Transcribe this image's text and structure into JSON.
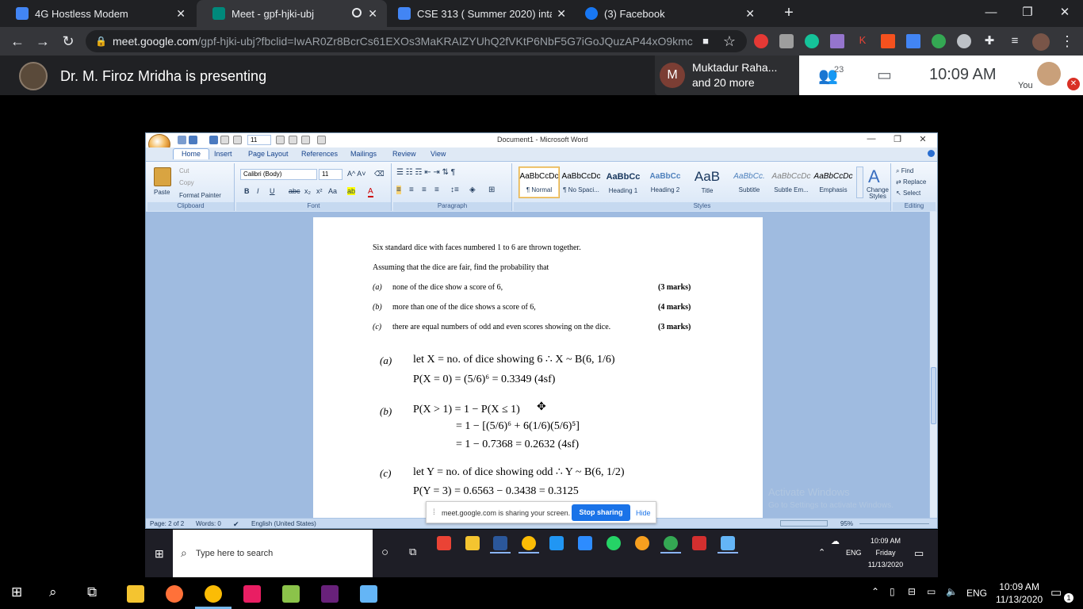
{
  "tabs": [
    {
      "label": "4G Hostless Modem",
      "color": "#4285f4"
    },
    {
      "label": "Meet - gpf-hjki-ubj",
      "color": "#00897b"
    },
    {
      "label": "CSE 313 ( Summer 2020) intake 3",
      "color": "#4285f4"
    },
    {
      "label": "(3) Facebook",
      "color": "#1877f2"
    }
  ],
  "window_controls": {
    "minimize": "—",
    "maximize": "❐",
    "close": "✕"
  },
  "new_tab": "+",
  "address": {
    "host": "meet.google.com",
    "path": "/gpf-hjki-ubj?fbclid=IwAR0Zr8BcrCs61EXOs3MaKRAIZYUhQ2fVKtP6NbF5G7iGoJQuzAP44xO9kmc"
  },
  "meet": {
    "presenting": "Dr. M. Firoz Mridha is presenting",
    "chip_initial": "M",
    "chip_line1": "Muktadur Raha...",
    "chip_line2": "and 20 more",
    "people_count": "23",
    "time": "10:09  AM",
    "you": "You"
  },
  "word": {
    "title": "Document1 - Microsoft Word",
    "qat_font_size": "11",
    "tabs": [
      "Home",
      "Insert",
      "Page Layout",
      "References",
      "Mailings",
      "Review",
      "View"
    ],
    "clipboard": {
      "paste": "Paste",
      "cut": "Cut",
      "copy": "Copy",
      "format_painter": "Format Painter",
      "label": "Clipboard"
    },
    "font": {
      "name": "Calibri (Body)",
      "size": "11",
      "label": "Font"
    },
    "paragraph_label": "Paragraph",
    "styles": [
      {
        "preview": "AaBbCcDc",
        "name": "¶ Normal"
      },
      {
        "preview": "AaBbCcDc",
        "name": "¶ No Spaci..."
      },
      {
        "preview": "AaBbCc",
        "name": "Heading 1"
      },
      {
        "preview": "AaBbCc",
        "name": "Heading 2"
      },
      {
        "preview": "AaB",
        "name": "Title"
      },
      {
        "preview": "AaBbCc.",
        "name": "Subtitle"
      },
      {
        "preview": "AaBbCcDc",
        "name": "Subtle Em..."
      },
      {
        "preview": "AaBbCcDc",
        "name": "Emphasis"
      }
    ],
    "styles_label": "Styles",
    "change_styles": "Change Styles",
    "editing": {
      "find": "Find",
      "replace": "Replace",
      "select": "Select",
      "label": "Editing"
    },
    "status": {
      "page": "Page: 2 of 2",
      "words": "Words: 0",
      "language": "English (United States)",
      "zoom": "95%"
    }
  },
  "document": {
    "intro1": "Six standard dice with faces numbered 1 to 6 are thrown together.",
    "intro2": "Assuming that the dice are fair, find the probability that",
    "questions": [
      {
        "label": "(a)",
        "text": "none of the dice show a score of 6,",
        "marks": "(3 marks)"
      },
      {
        "label": "(b)",
        "text": "more than one of the dice shows a score of 6,",
        "marks": "(4 marks)"
      },
      {
        "label": "(c)",
        "text": "there are equal numbers of odd and even scores showing on the dice.",
        "marks": "(3 marks)"
      }
    ],
    "solutions": {
      "a_label": "(a)",
      "a_line1": "let X = no. of dice showing 6  ∴ X ~ B(6, 1/6)",
      "a_line2": "P(X = 0) = (5/6)⁶ = 0.3349 (4sf)",
      "b_label": "(b)",
      "b_line1": "P(X > 1) = 1 − P(X ≤ 1)",
      "b_line2": "= 1 − [(5/6)⁶ + 6(1/6)(5/6)⁵]",
      "b_line3": "= 1 − 0.7368 = 0.2632 (4sf)",
      "c_label": "(c)",
      "c_line1": "let Y = no. of dice showing odd  ∴ Y ~ B(6, 1/2)",
      "c_line2": "P(Y = 3) = 0.6563 − 0.3438 = 0.3125"
    },
    "watermark1": "Activate Windows",
    "watermark2": "Go to Settings to activate Windows."
  },
  "share_bar": {
    "text": "meet.google.com is sharing your screen.",
    "stop": "Stop sharing",
    "hide": "Hide"
  },
  "inner_taskbar": {
    "search_placeholder": "Type here to search",
    "lang": "ENG",
    "time": "10:09 AM",
    "day": "Friday",
    "date": "11/13/2020"
  },
  "outer_taskbar": {
    "lang": "ENG",
    "time": "10:09 AM",
    "date": "11/13/2020",
    "notifications": "1"
  }
}
